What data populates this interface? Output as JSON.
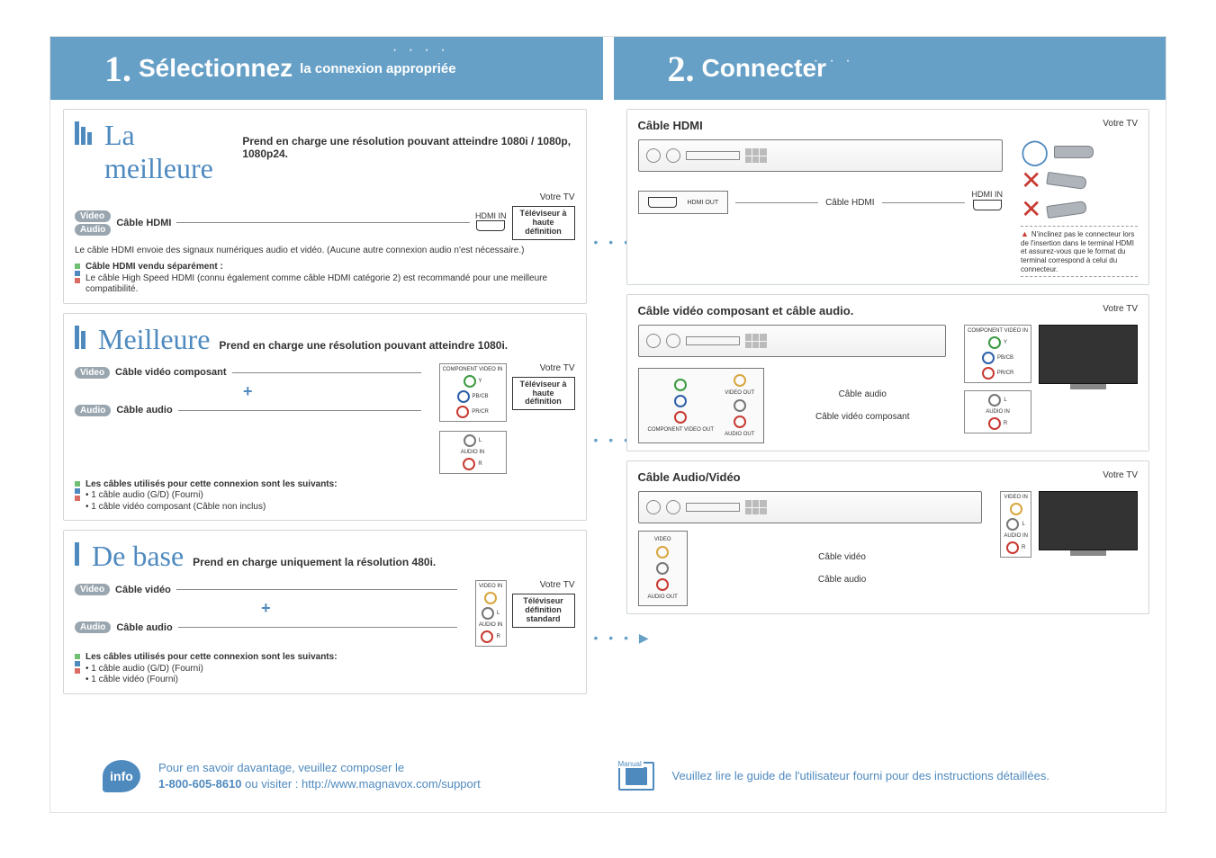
{
  "header": {
    "step1_num": "1.",
    "step1_big": "Sélectionnez",
    "step1_sub": "la connexion appropriée",
    "step2_num": "2.",
    "step2_big": "Connecter"
  },
  "best": {
    "title": "La meilleure",
    "subtitle": "Prend en charge une résolution pouvant atteindre 1080i / 1080p, 1080p24.",
    "video_pill": "Video",
    "audio_pill": "Audio",
    "cable": "Câble HDMI",
    "hdmi_in": "HDMI IN",
    "tvbox": "Téléviseur à haute définition",
    "your_tv": "Votre TV",
    "note1": "Le câble HDMI envoie des signaux numériques audio et vidéo. (Aucune autre connexion audio n'est nécessaire.)",
    "note2_title": "Câble HDMI vendu séparément :",
    "note2": "Le câble High Speed HDMI (connu également comme câble HDMI catégorie 2) est recommandé pour une meilleure compatibilité."
  },
  "better": {
    "title": "Meilleure",
    "subtitle": "Prend en charge une résolution pouvant atteindre 1080i.",
    "video_pill": "Video",
    "audio_pill": "Audio",
    "cable_v": "Câble vidéo composant",
    "cable_a": "Câble audio",
    "comp_in": "COMPONENT VIDEO IN",
    "audio_in": "AUDIO IN",
    "y": "Y",
    "pb": "PB/CB",
    "pr": "PR/CR",
    "l": "L",
    "r": "R",
    "tvbox": "Téléviseur à haute définition",
    "your_tv": "Votre TV",
    "note_title": "Les câbles utilisés pour cette connexion sont les suivants:",
    "note_l1": "• 1 câble audio (G/D) (Fourni)",
    "note_l2": "• 1 câble vidéo composant (Câble non inclus)"
  },
  "basic": {
    "title": "De base",
    "subtitle": "Prend en charge uniquement la résolution 480i.",
    "video_pill": "Video",
    "audio_pill": "Audio",
    "cable_v": "Câble vidéo",
    "cable_a": "Câble audio",
    "video_in": "VIDEO IN",
    "audio_in": "AUDIO IN",
    "l": "L",
    "r": "R",
    "tvbox": "Téléviseur définition standard",
    "your_tv": "Votre TV",
    "note_title": "Les câbles utilisés pour cette connexion sont les suivants:",
    "note_l1": "• 1 câble audio (G/D) (Fourni)",
    "note_l2": "• 1 câble vidéo (Fourni)"
  },
  "right": {
    "hdmi": {
      "head": "Câble HDMI",
      "your_tv": "Votre TV",
      "cable": "Câble HDMI",
      "hdmi_in": "HDMI IN",
      "hdmi_out": "HDMI OUT",
      "warn": "N'inclinez pas le connecteur lors de l'insertion dans le terminal HDMI et assurez-vous que le format du terminal correspond à celui du connecteur."
    },
    "component": {
      "head": "Câble vidéo composant et câble audio.",
      "your_tv": "Votre TV",
      "cable_a": "Câble audio",
      "cable_v": "Câble vidéo composant",
      "comp_in": "COMPONENT VIDEO IN",
      "audio_in": "AUDIO IN",
      "video_out": "VIDEO OUT",
      "comp_out": "COMPONENT VIDEO OUT",
      "audio_out": "AUDIO OUT",
      "y": "Y",
      "pb": "PB/CB",
      "pr": "PR/CR",
      "l": "L",
      "r": "R"
    },
    "av": {
      "head": "Câble Audio/Vidéo",
      "your_tv": "Votre TV",
      "cable_v": "Câble vidéo",
      "cable_a": "Câble audio",
      "video_in": "VIDEO IN",
      "audio_in": "AUDIO IN",
      "audio_out": "AUDIO OUT",
      "video": "VIDEO",
      "l": "L",
      "r": "R"
    }
  },
  "footer": {
    "info_text": "Pour en savoir davantage, veuillez composer le",
    "phone": "1-800-605-8610",
    "visit": " ou visiter : http://www.magnavox.com/support",
    "manual_label": "Manual",
    "manual_text": "Veuillez lire le guide de l'utilisateur fourni pour des instructions détaillées."
  }
}
